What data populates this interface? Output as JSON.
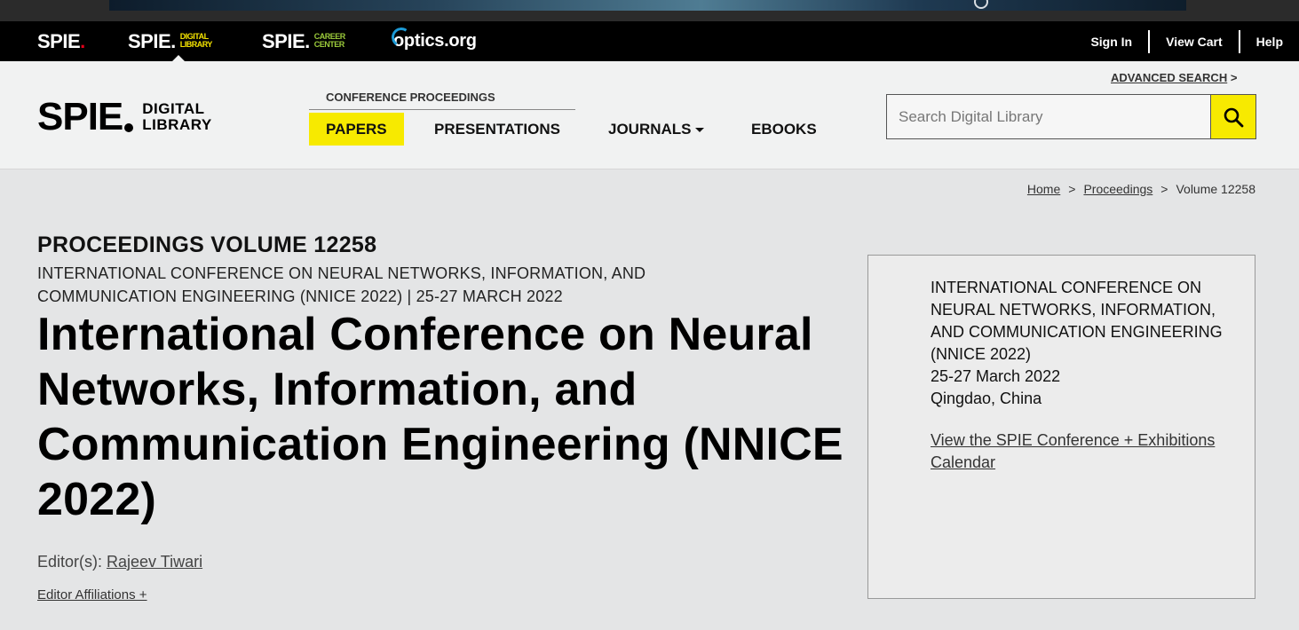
{
  "network_bar": {
    "spie": "SPIE",
    "digital_library_top": "DIGITAL",
    "digital_library_bottom": "LIBRARY",
    "career_top": "CAREER",
    "career_bottom": "CENTER",
    "optics": "optics.org",
    "links": [
      "Sign In",
      "View Cart",
      "Help"
    ]
  },
  "header": {
    "logo_big": "SPIE",
    "logo_small_top": "DIGITAL",
    "logo_small_bottom": "LIBRARY",
    "conference_proceedings_label": "CONFERENCE PROCEEDINGS",
    "nav": {
      "papers": "PAPERS",
      "presentations": "PRESENTATIONS",
      "journals": "JOURNALS",
      "ebooks": "EBOOKS"
    },
    "advanced_search": "ADVANCED SEARCH",
    "advanced_search_arrow": ">",
    "search_placeholder": "Search Digital Library"
  },
  "breadcrumb": {
    "home": "Home",
    "proceedings": "Proceedings",
    "current": "Volume 12258",
    "separator": ">"
  },
  "main": {
    "volume_title": "PROCEEDINGS VOLUME 12258",
    "conference_subtitle": "INTERNATIONAL CONFERENCE ON NEURAL NETWORKS, INFORMATION, AND COMMUNICATION ENGINEERING (NNICE 2022) | 25-27 MARCH 2022",
    "title": "International Conference on Neural Networks, Information, and Communication Engineering (NNICE 2022)",
    "editors_label": "Editor(s):",
    "editor_name": "Rajeev Tiwari",
    "editor_affiliations": "Editor Affiliations +"
  },
  "info_box": {
    "conference_name": "INTERNATIONAL CONFERENCE ON NEURAL NETWORKS, INFORMATION, AND COMMUNICATION ENGINEERING (NNICE 2022)",
    "dates": "25-27 March 2022",
    "location": "Qingdao, China",
    "calendar_link": "View the SPIE Conference + Exhibitions Calendar"
  }
}
